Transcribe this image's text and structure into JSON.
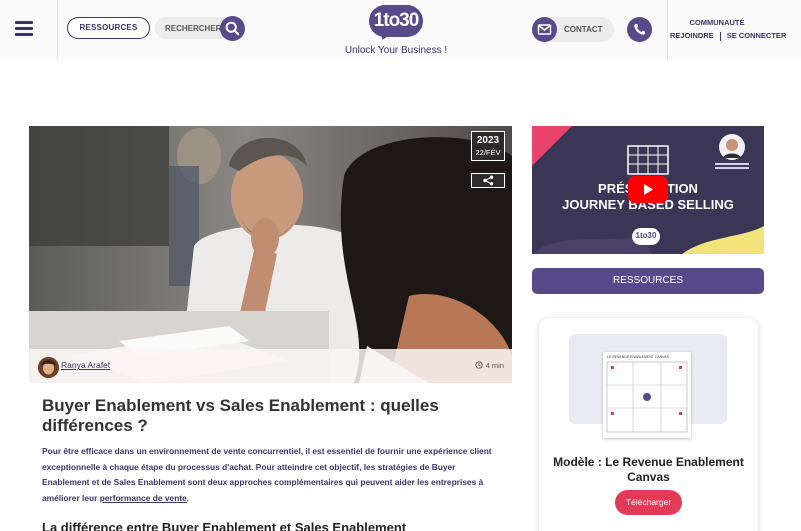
{
  "header": {
    "ressources_label": "RESSOURCES",
    "search_placeholder": "RECHERCHER",
    "logo_text": "1to30",
    "tagline": "Unlock Your Business !",
    "contact_label": "CONTACT",
    "community_title": "COMMUNAUTÉ",
    "join_label": "REJOINDRE",
    "login_label": "SE CONNECTER"
  },
  "article": {
    "date_year": "2023",
    "date_day": "22/FÉV",
    "author": "Ranya Arafet",
    "read_time": "4 min",
    "title": "Buyer Enablement vs Sales Enablement : quelles différences ?",
    "intro": "Pour être efficace dans un environnement de vente concurrentiel, il est essentiel de fournir une expérience client exceptionnelle à chaque étape du processus d'achat. Pour atteindre cet objectif, les stratégies de Buyer Enablement et de Sales Enablement sont deux approches complémentaires qui peuvent aider les entreprises à améliorer leur",
    "intro_link": "performance de vente",
    "intro_end": ".",
    "section_heading": "La différence entre Buyer Enablement et Sales Enablement"
  },
  "sidebar": {
    "video_line1": "PRÉSENTATION",
    "video_line2": "JOURNEY BASED SELLING",
    "video_logo": "1to30",
    "ressources_button": "RESSOURCES",
    "canvas_thumb_title": "LE REVENUE ENABLEMENT CANVAS",
    "canvas_title": "Modèle : Le Revenue Enablement Canvas",
    "download_button": "Télécharger"
  },
  "colors": {
    "brand_purple": "#574a8a",
    "brand_dark": "#3d3467",
    "cta_red": "#e23a57",
    "youtube_red": "#ff0000"
  },
  "icons": [
    "menu-icon",
    "search-icon",
    "mail-icon",
    "phone-icon",
    "share-icon",
    "clock-icon",
    "play-icon"
  ]
}
